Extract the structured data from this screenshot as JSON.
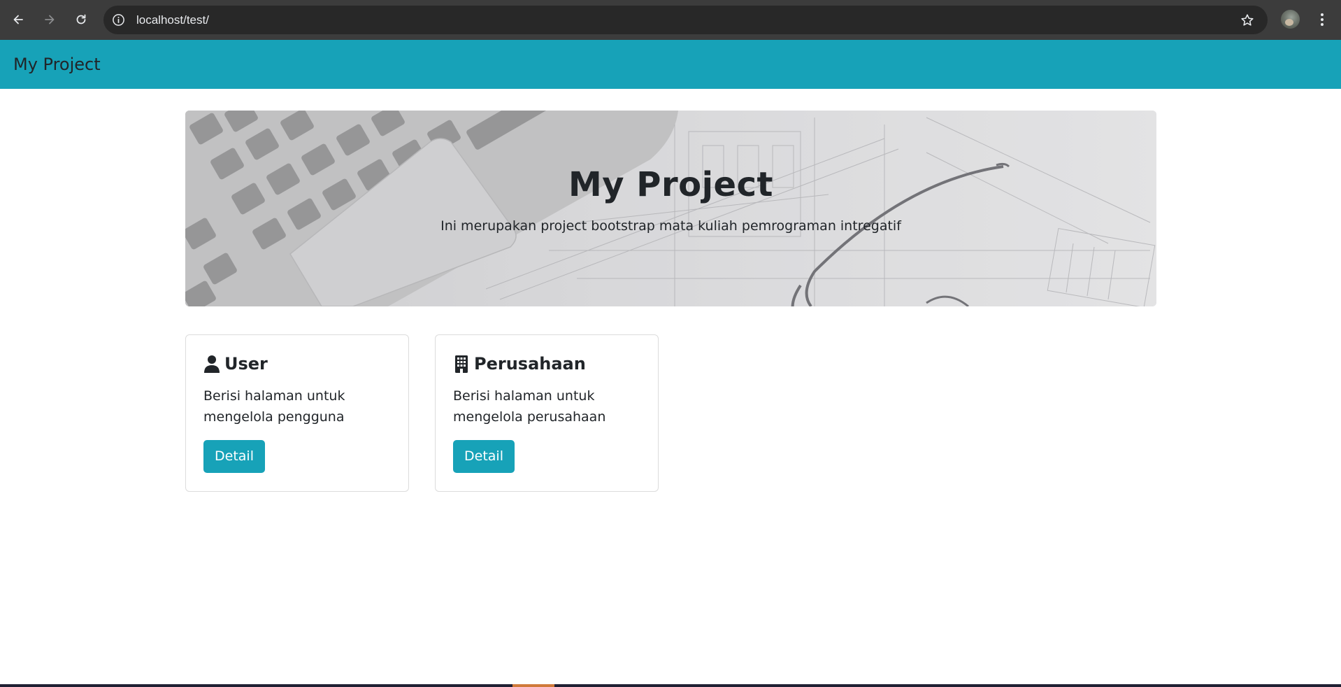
{
  "browser": {
    "url": "localhost/test/",
    "icons": {
      "back": "arrow-left-icon",
      "forward": "arrow-right-icon",
      "reload": "reload-icon",
      "info": "info-icon",
      "bookmark": "star-icon",
      "menu": "kebab-menu-icon"
    }
  },
  "navbar": {
    "brand": "My Project"
  },
  "jumbotron": {
    "title": "My Project",
    "lead": "Ini merupakan project bootstrap mata kuliah pemrograman intregatif"
  },
  "cards": [
    {
      "icon": "user-icon",
      "title": "User",
      "text": "Berisi halaman untuk mengelola pengguna",
      "button": "Detail"
    },
    {
      "icon": "building-icon",
      "title": "Perusahaan",
      "text": "Berisi halaman untuk mengelola perusahaan",
      "button": "Detail"
    }
  ],
  "colors": {
    "brand": "#17a2b8",
    "text": "#212529",
    "browser_chrome": "#3c3c3c",
    "omnibox": "#282828"
  }
}
